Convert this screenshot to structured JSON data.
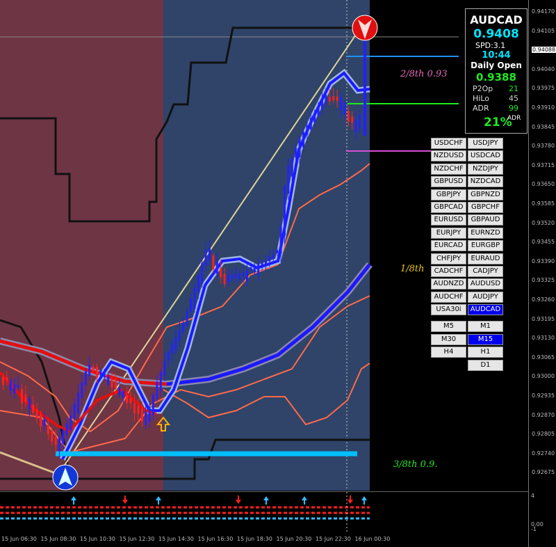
{
  "symbol_panel": {
    "symbol": "AUDCAD",
    "bid": "0.9408",
    "spread": "SPD:3.1",
    "time": "10:44",
    "daily_open_label": "Daily Open",
    "daily_open_value": "0.9388",
    "p2op_label": "P2Op",
    "p2op_value": "21",
    "hilo_label": "HiLo",
    "hilo_value": "45",
    "adr_label": "ADR",
    "adr_value": "99",
    "adr_percent": "21%",
    "adr_small": "ADR"
  },
  "pairs": [
    [
      "USDCHF",
      "USDJPY"
    ],
    [
      "NZDUSD",
      "USDCAD"
    ],
    [
      "NZDCHF",
      "NZDJPY"
    ],
    [
      "GBPUSD",
      "NZDCAD"
    ],
    [
      "GBPJPY",
      "GBPNZD"
    ],
    [
      "GBPCAD",
      "GBPCHF"
    ],
    [
      "EURUSD",
      "GBPAUD"
    ],
    [
      "EURJPY",
      "EURNZD"
    ],
    [
      "EURCAD",
      "EURGBP"
    ],
    [
      "CHFJPY",
      "EURAUD"
    ],
    [
      "CADCHF",
      "CADJPY"
    ],
    [
      "AUDNZD",
      "AUDUSD"
    ],
    [
      "AUDCHF",
      "AUDJPY"
    ],
    [
      "USA30i",
      "AUDCAD"
    ]
  ],
  "active_pair": "AUDCAD",
  "timeframes": [
    [
      "M5",
      "M1"
    ],
    [
      "M30",
      "M15"
    ],
    [
      "H4",
      "H1"
    ],
    [
      "",
      "D1"
    ]
  ],
  "active_timeframe": "M15",
  "fib_labels": {
    "two_eighths": "2/8th  0.93",
    "one_eighth": "1/8th",
    "three_eighths": "3/8th  0.9."
  },
  "price_ticks": [
    "0.94170",
    "0.94105",
    "0.94088",
    "0.94040",
    "0.93975",
    "0.93910",
    "0.93845",
    "0.93780",
    "0.93715",
    "0.93650",
    "0.93585",
    "0.93520",
    "0.93455",
    "0.93390",
    "0.93325",
    "0.93260",
    "0.93195",
    "0.93130",
    "0.93065",
    "0.93000",
    "0.92935",
    "0.92870",
    "0.92805",
    "0.92740",
    "0.92675"
  ],
  "highlighted_tick": "0.94088",
  "sub_ticks": [
    "4",
    "0.00",
    "-1"
  ],
  "time_labels": [
    "15 Jun 06:30",
    "15 Jun 08:30",
    "15 Jun 10:30",
    "15 Jun 12:30",
    "15 Jun 14:30",
    "15 Jun 16:30",
    "15 Jun 18:30",
    "15 Jun 20:30",
    "15 Jun 22:30",
    "16 Jun 00:30"
  ],
  "colors": {
    "bull": "#2222ff",
    "bear": "#ff2020",
    "zone_left": "#6e3545",
    "zone_right": "#2f4468",
    "accent": "#00e5ff",
    "green": "#21e821"
  }
}
